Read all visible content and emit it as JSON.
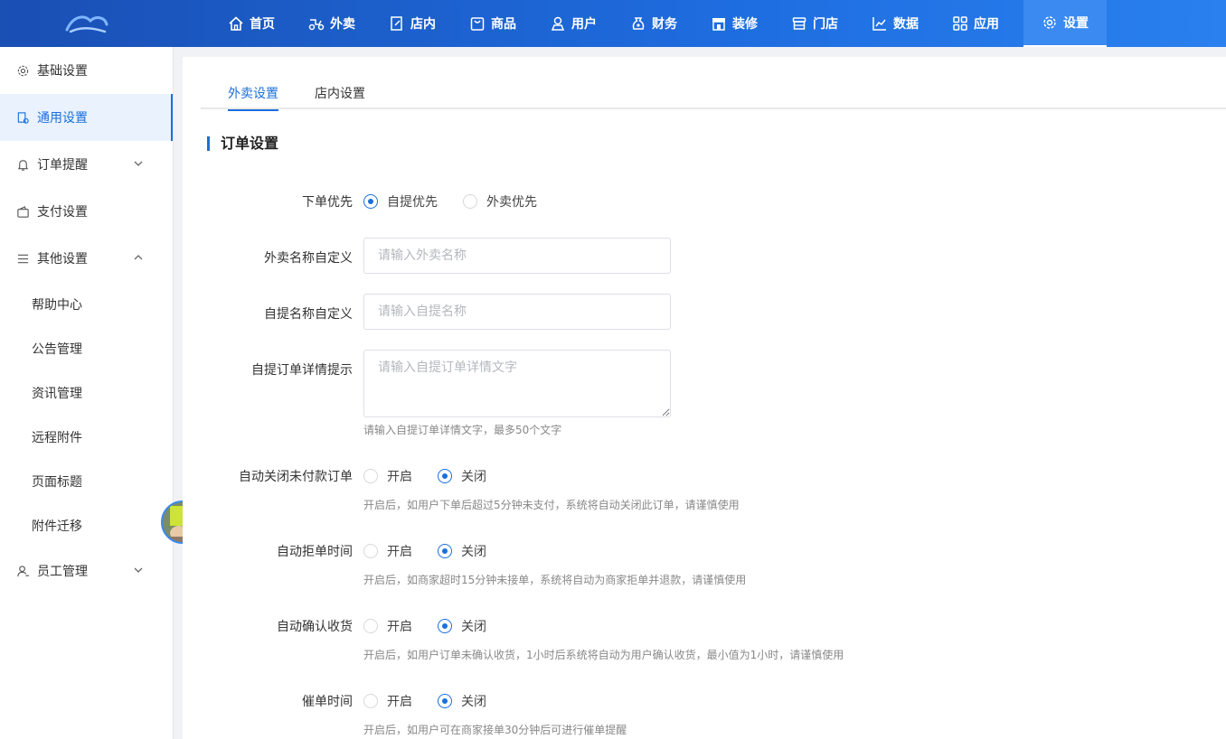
{
  "colors": {
    "primary": "#1a6fdc",
    "topbar": "#1e6de0"
  },
  "nav": [
    {
      "label": "首页",
      "icon": "home-icon"
    },
    {
      "label": "外卖",
      "icon": "scooter-icon"
    },
    {
      "label": "店内",
      "icon": "edit-doc-icon"
    },
    {
      "label": "商品",
      "icon": "shopping-bag-icon"
    },
    {
      "label": "用户",
      "icon": "user-icon"
    },
    {
      "label": "财务",
      "icon": "money-bag-icon"
    },
    {
      "label": "装修",
      "icon": "storefront-icon"
    },
    {
      "label": "门店",
      "icon": "store-icon"
    },
    {
      "label": "数据",
      "icon": "line-chart-icon"
    },
    {
      "label": "应用",
      "icon": "apps-grid-icon"
    },
    {
      "label": "设置",
      "icon": "gear-icon",
      "active": true
    }
  ],
  "sidebar": {
    "items": [
      {
        "label": "基础设置",
        "icon": "gear-icon"
      },
      {
        "label": "通用设置",
        "icon": "document-icon",
        "active": true
      },
      {
        "label": "订单提醒",
        "icon": "bell-icon",
        "chevron": "down"
      },
      {
        "label": "支付设置",
        "icon": "wallet-icon"
      },
      {
        "label": "其他设置",
        "icon": "menu-lines-icon",
        "chevron": "up"
      }
    ],
    "sub_items": [
      "帮助中心",
      "公告管理",
      "资讯管理",
      "远程附件",
      "页面标题",
      "附件迁移"
    ],
    "staff": {
      "label": "员工管理",
      "icon": "staff-icon",
      "chevron": "down"
    }
  },
  "tabs": [
    {
      "label": "外卖设置",
      "active": true
    },
    {
      "label": "店内设置"
    }
  ],
  "section_title": "订单设置",
  "form": {
    "order_priority": {
      "label": "下单优先",
      "options": [
        "自提优先",
        "外卖优先"
      ],
      "selected": 0
    },
    "delivery_name": {
      "label": "外卖名称自定义",
      "placeholder": "请输入外卖名称",
      "value": ""
    },
    "pickup_name": {
      "label": "自提名称自定义",
      "placeholder": "请输入自提名称",
      "value": ""
    },
    "pickup_tip": {
      "label": "自提订单详情提示",
      "placeholder": "请输入自提订单详情文字",
      "value": "",
      "hint": "请输入自提订单详情文字，最多50个文字"
    },
    "auto_close": {
      "label": "自动关闭未付款订单",
      "options": [
        "开启",
        "关闭"
      ],
      "selected": 1,
      "hint": "开启后，如用户下单后超过5分钟未支付，系统将自动关闭此订单，请谨慎使用"
    },
    "auto_reject": {
      "label": "自动拒单时间",
      "options": [
        "开启",
        "关闭"
      ],
      "selected": 1,
      "hint": "开启后，如商家超时15分钟未接单，系统将自动为商家拒单并退款，请谨慎使用"
    },
    "auto_confirm": {
      "label": "自动确认收货",
      "options": [
        "开启",
        "关闭"
      ],
      "selected": 1,
      "hint": "开启后，如用户订单未确认收货，1小时后系统将自动为用户确认收货，最小值为1小时，请谨慎使用"
    },
    "reminder": {
      "label": "催单时间",
      "options": [
        "开启",
        "关闭"
      ],
      "selected": 1,
      "hint": "开启后，如用户可在商家接单30分钟后可进行催单提醒"
    }
  }
}
